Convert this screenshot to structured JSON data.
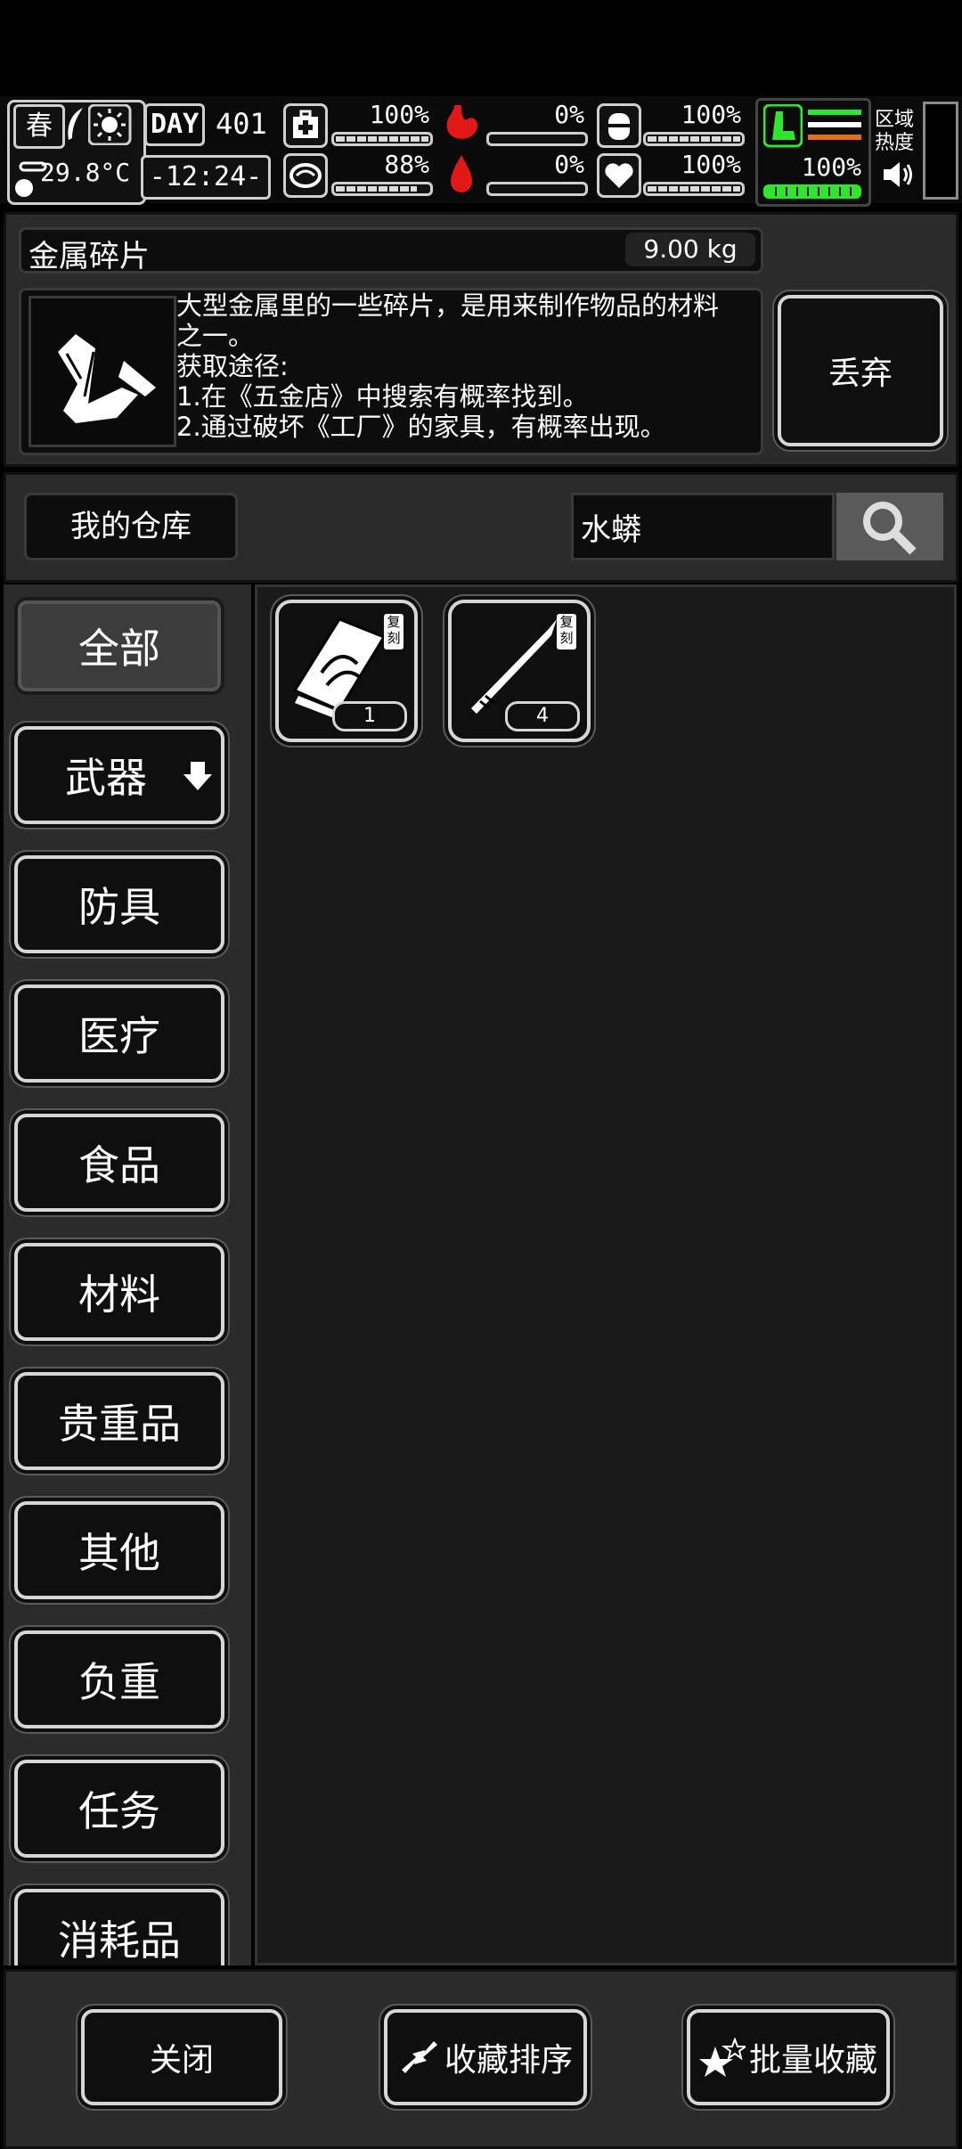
{
  "hud": {
    "season": "春",
    "temperature": "29.8°C",
    "day_label": "DAY",
    "day_number": "401",
    "time": "-12:24-",
    "stats": [
      {
        "name": "medical",
        "value": "100%",
        "level": 1.0
      },
      {
        "name": "hunger",
        "value": "0%",
        "level": 0.0
      },
      {
        "name": "drink",
        "value": "100%",
        "level": 1.0
      },
      {
        "name": "mental",
        "value": "88%",
        "level": 0.88
      },
      {
        "name": "thirst",
        "value": "0%",
        "level": 0.0
      },
      {
        "name": "health",
        "value": "100%",
        "level": 1.0
      }
    ],
    "stamina": "100%",
    "zone_heat_label_1": "区域",
    "zone_heat_label_2": "热度"
  },
  "detail": {
    "item_name": "金属碎片",
    "weight": "9.00 kg",
    "desc_1": "大型金属里的一些碎片，是用来制作物品的材料",
    "desc_2": "之一。",
    "desc_3": "获取途径:",
    "desc_4": "1.在《五金店》中搜索有概率找到。",
    "desc_5": "2.通过破坏《工厂》的家具，有概率出现。",
    "discard_label": "丢弃"
  },
  "storage": {
    "title": "我的仓库",
    "search_value": "水蟒"
  },
  "categories": [
    {
      "label": "全部",
      "selected": true
    },
    {
      "label": "武器"
    },
    {
      "label": "防具"
    },
    {
      "label": "医疗"
    },
    {
      "label": "食品"
    },
    {
      "label": "材料"
    },
    {
      "label": "贵重品"
    },
    {
      "label": "其他"
    },
    {
      "label": "负重"
    },
    {
      "label": "任务"
    },
    {
      "label": "消耗品"
    }
  ],
  "items": [
    {
      "icon": "blueprint-scroll-icon",
      "badge": "复刻",
      "count": "1"
    },
    {
      "icon": "spear-icon",
      "badge": "复刻",
      "count": "4"
    }
  ],
  "footer": {
    "close_label": "关闭",
    "sort_label": "收藏排序",
    "batch_label": "批量收藏"
  },
  "colors": {
    "accent_green": "#2ee62e",
    "danger_red": "#e01818",
    "orange": "#e07010"
  }
}
